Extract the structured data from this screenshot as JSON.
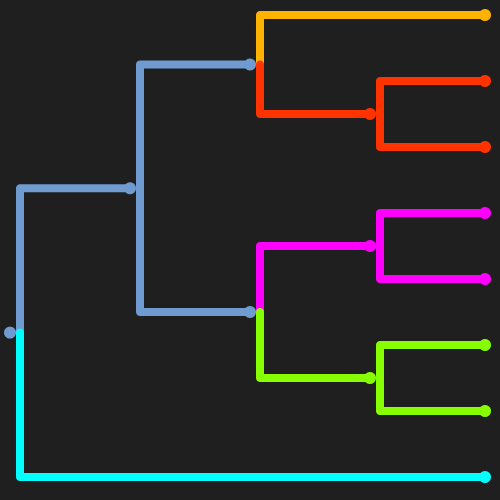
{
  "colors": {
    "background": "#1f1f1f",
    "internal": "#6f9bd1",
    "orange": "#ffb300",
    "red": "#ff3300",
    "magenta": "#ff00ff",
    "green": "#88ff00",
    "cyan": "#00ffff"
  },
  "tree": {
    "id": "root",
    "color": "internal",
    "children": [
      {
        "id": "n1",
        "color": "internal",
        "children": [
          {
            "id": "n2",
            "color": "internal",
            "children": [
              {
                "id": "leaf-1",
                "color": "orange"
              },
              {
                "id": "n4",
                "color": "red",
                "children": [
                  {
                    "id": "leaf-2",
                    "color": "red"
                  },
                  {
                    "id": "leaf-3",
                    "color": "red"
                  }
                ]
              }
            ]
          },
          {
            "id": "n3",
            "color": "internal",
            "children": [
              {
                "id": "n5",
                "color": "magenta",
                "children": [
                  {
                    "id": "leaf-4",
                    "color": "magenta"
                  },
                  {
                    "id": "leaf-5",
                    "color": "magenta"
                  }
                ]
              },
              {
                "id": "n6",
                "color": "green",
                "children": [
                  {
                    "id": "leaf-6",
                    "color": "green"
                  },
                  {
                    "id": "leaf-7",
                    "color": "green"
                  }
                ]
              }
            ]
          }
        ]
      },
      {
        "id": "leaf-8",
        "color": "cyan"
      }
    ]
  }
}
